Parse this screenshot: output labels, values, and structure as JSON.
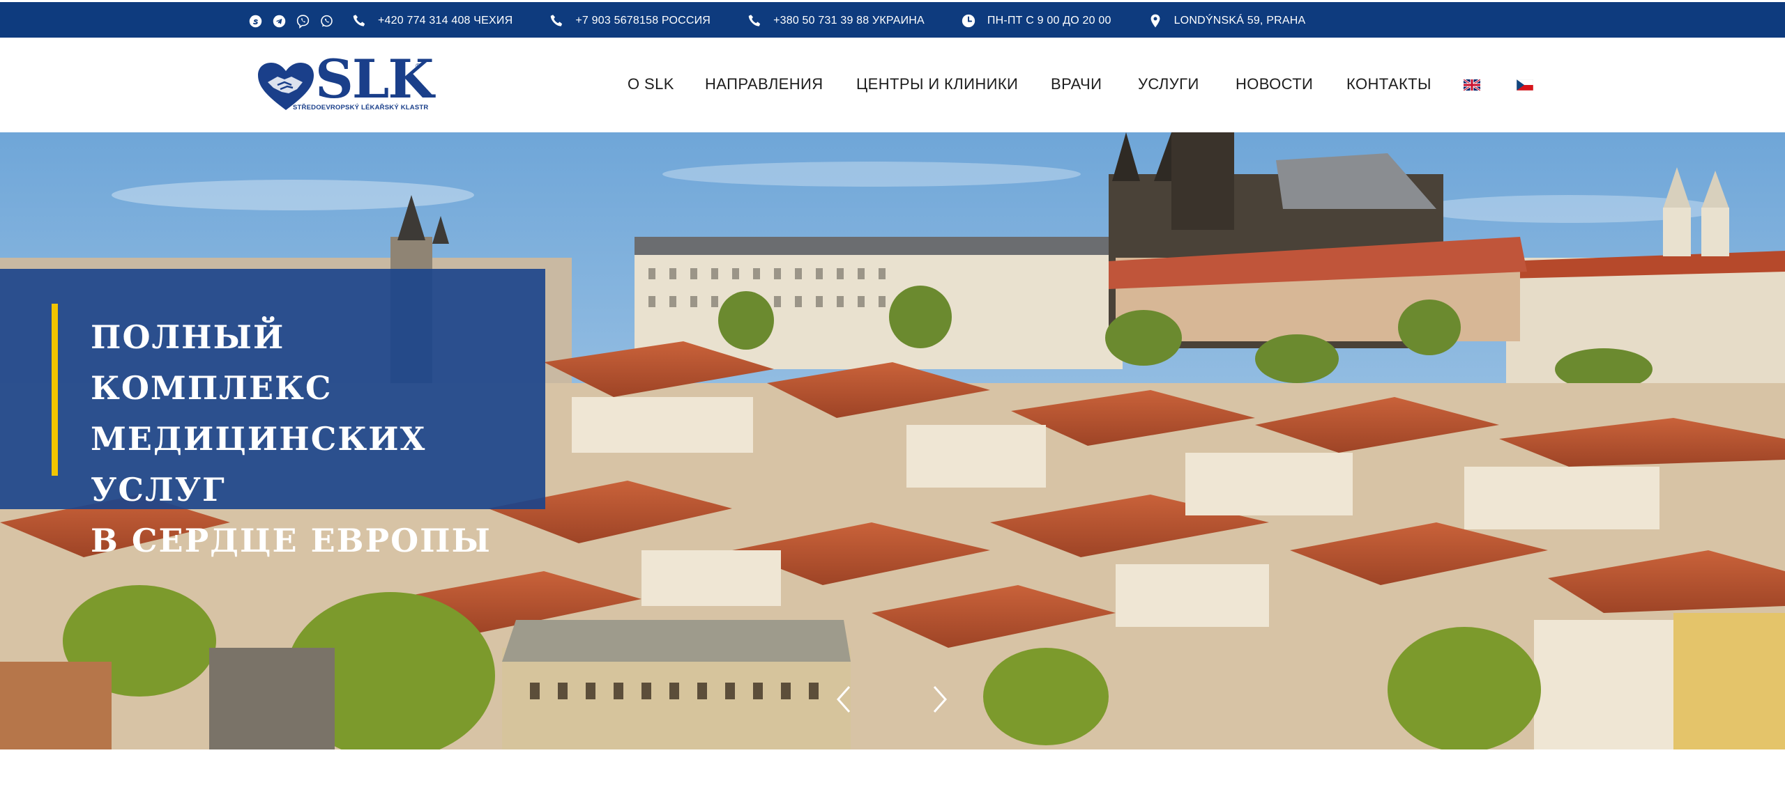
{
  "topbar": {
    "social": [
      {
        "icon": "skype-icon"
      },
      {
        "icon": "telegram-icon"
      },
      {
        "icon": "viber-icon"
      },
      {
        "icon": "whatsapp-icon"
      }
    ],
    "contacts": [
      {
        "icon": "phone-icon",
        "text": "+420 774 314 408 ЧЕХИЯ"
      },
      {
        "icon": "phone-icon",
        "text": "+7 903 5678158 РОССИЯ"
      },
      {
        "icon": "phone-icon",
        "text": "+380 50 731 39 88 УКРАИНА"
      },
      {
        "icon": "clock-icon",
        "text": "ПН-ПТ С 9 00 ДО 20 00"
      },
      {
        "icon": "map-pin-icon",
        "text": "LONDÝNSKÁ 59, PRAHA"
      }
    ],
    "background": "#0e3b7e"
  },
  "logo": {
    "text": "SLK",
    "registered": "®",
    "subtitle": "STŘEDOEVROPSKÝ LÉKAŘSKÝ KLASTR",
    "color": "#1a3f8a"
  },
  "nav": {
    "items": [
      {
        "label": "O SLK"
      },
      {
        "label": "НАПРАВЛЕНИЯ"
      },
      {
        "label": "ЦЕНТРЫ И КЛИНИКИ"
      },
      {
        "label": "ВРАЧИ"
      },
      {
        "label": "УСЛУГИ"
      },
      {
        "label": "НОВОСТИ"
      },
      {
        "label": "КОНТАКТЫ"
      }
    ],
    "flags": [
      {
        "icon": "uk-flag-icon"
      },
      {
        "icon": "czech-flag-icon"
      }
    ]
  },
  "hero": {
    "title_lines": [
      "ПОЛНЫЙ КОМПЛЕКС",
      "МЕДИЦИНСКИХ УСЛУГ",
      "В СЕРДЦЕ ЕВРОПЫ"
    ],
    "box_color": "#1a448c",
    "accent_color": "#f2c500",
    "prev_icon": "chevron-left-icon",
    "next_icon": "chevron-right-icon"
  }
}
